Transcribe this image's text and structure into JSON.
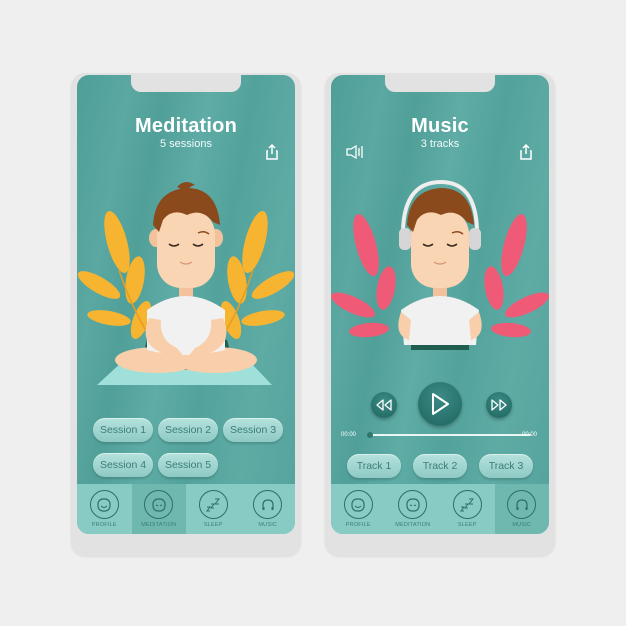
{
  "meditation_screen": {
    "title": "Meditation",
    "subtitle": "5 sessions",
    "share_icon": "share-icon",
    "sessions": [
      "Session 1",
      "Session 2",
      "Session 3",
      "Session 4",
      "Session 5"
    ],
    "leaf_color": "#f6b431"
  },
  "music_screen": {
    "title": "Music",
    "subtitle": "3 tracks",
    "speaker_icon": "speaker-icon",
    "share_icon": "share-icon",
    "player": {
      "elapsed": "00:00",
      "duration": "00:00",
      "progress": 0,
      "rewind_icon": "rewind-icon",
      "play_icon": "play-icon",
      "forward_icon": "fast-forward-icon"
    },
    "tracks": [
      "Track 1",
      "Track 2",
      "Track 3"
    ],
    "leaf_color": "#ef5b77"
  },
  "bottom_nav": {
    "items": [
      {
        "label": "PROFILE",
        "icon": "smiley-face-icon"
      },
      {
        "label": "MEDITATION",
        "icon": "calm-face-icon"
      },
      {
        "label": "SLEEP",
        "icon": "zzz-icon"
      },
      {
        "label": "MUSIC",
        "icon": "headphones-icon"
      }
    ],
    "active_left": "MEDITATION",
    "active_right": "MUSIC"
  },
  "colors": {
    "screen_bg": "#57a59f",
    "nav_bg": "#88cbc4",
    "nav_active": "#6fb8b0",
    "button_text": "#3b7d78"
  }
}
